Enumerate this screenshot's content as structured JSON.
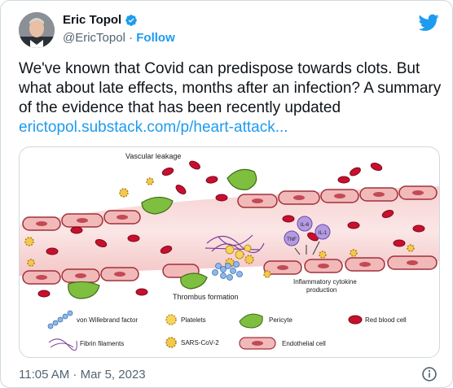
{
  "author": {
    "name": "Eric Topol",
    "handle": "@EricTopol",
    "separator": "·",
    "follow_label": "Follow"
  },
  "tweet": {
    "text": "We've known that Covid can predispose towards clots. But what about late effects, months after an infection? A summary of the evidence that has been recently updated",
    "link_text": "erictopol.substack.com/p/heart-attack..."
  },
  "figure": {
    "vascular_leakage": "Vascular leakage",
    "thrombus_formation": "Thrombus formation",
    "cytokine_line1": "Inflammatory cytokine",
    "cytokine_line2": "production",
    "cytokines": [
      "IL-6",
      "TNF",
      "IL-1"
    ],
    "legend": {
      "vwf": "von Willebrand factor",
      "platelets": "Platelets",
      "pericyte": "Pericyte",
      "rbc": "Red blood cell",
      "fibrin": "Fibrin filaments",
      "sars": "SARS-CoV-2",
      "endothelial": "Endothelial cell"
    }
  },
  "meta": {
    "timestamp": "11:05 AM · Mar 5, 2023"
  },
  "colors": {
    "link": "#1d9bf0",
    "text": "#0f1419",
    "muted": "#536471",
    "red_blood_cell": "#c8102e",
    "endothelial": "#f2b9b9",
    "pericyte": "#7fbf3f"
  },
  "icons": {
    "verified": "verified-badge-icon",
    "twitter": "twitter-bird-icon",
    "info": "info-icon"
  }
}
